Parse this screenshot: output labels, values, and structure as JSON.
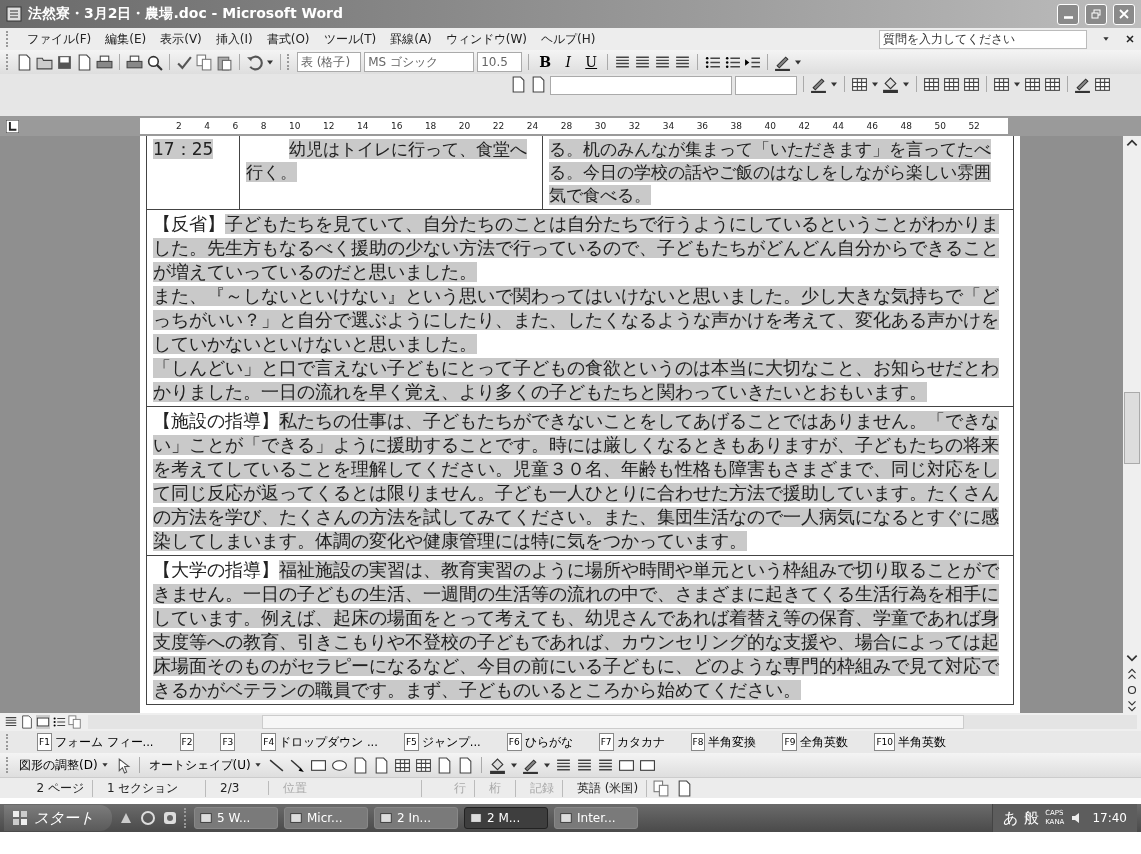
{
  "window": {
    "title": "法然寮・3月2日・農場.doc - Microsoft Word"
  },
  "menu": [
    {
      "label": "ファイル(F)"
    },
    {
      "label": "編集(E)"
    },
    {
      "label": "表示(V)"
    },
    {
      "label": "挿入(I)"
    },
    {
      "label": "書式(O)"
    },
    {
      "label": "ツール(T)"
    },
    {
      "label": "罫線(A)"
    },
    {
      "label": "ウィンドウ(W)"
    },
    {
      "label": "ヘルプ(H)"
    }
  ],
  "help_box": {
    "placeholder": "質問を入力してください"
  },
  "formatting": {
    "style": "表 (格子)",
    "font": "MS ゴシック",
    "size": "10.5",
    "buttons": [
      "B",
      "I",
      "U"
    ]
  },
  "ruler": [
    "2",
    "4",
    "6",
    "8",
    "10",
    "12",
    "14",
    "16",
    "18",
    "20",
    "22",
    "24",
    "28",
    "30",
    "32",
    "34",
    "36",
    "38",
    "40",
    "42",
    "44",
    "46",
    "48",
    "50",
    "52"
  ],
  "schedule_row": {
    "time": "17：25",
    "activity": "幼児はトイレに行って、食堂へ行く。",
    "support": "る。机のみんなが集まって「いただきます」を言ってたべる。今日の学校の話やご飯のはなしをしながら楽しい雰囲気で食べる。"
  },
  "sections": [
    {
      "label": "【反省】",
      "paragraphs": [
        "子どもたちを見ていて、自分たちのことは自分たちで行うようにしているということがわかりました。先生方もなるべく援助の少ない方法で行っているので、子どもたちがどんどん自分からできることが増えていっているのだと思いました。",
        "また、『～しないといけない』という思いで関わってはいけないと思いました。少し大きな気持ちで「どっちがいい？」と自分で選ぶようにしたり、また、したくなるような声かけを考えて、変化ある声かけをしていかないといけないと思いました。",
        "「しんどい」と口で言えない子どもにとって子どもの食欲というのは本当に大切なこと、お知らせだとわかりました。一日の流れを早く覚え、より多くの子どもたちと関わっていきたいとおもいます。"
      ]
    },
    {
      "label": "【施設の指導】",
      "paragraphs": [
        "私たちの仕事は、子どもたちができないことをしてあげることではありません。「できない」ことが「できる」ように援助することです。時には厳しくなるときもありますが、子どもたちの将来を考えてしていることを理解してください。児童３０名、年齢も性格も障害もさまざまで、同じ対応をして同じ反応が返ってくるとは限りません。子ども一人ひとりに合わせた方法で援助しています。たくさんの方法を学び、たくさんの方法を試してみてください。また、集団生活なので一人病気になるとすぐに感染してしまいます。体調の変化や健康管理には特に気をつかっています。"
      ]
    },
    {
      "label": "【大学の指導】",
      "paragraphs": [
        "福祉施設の実習は、教育実習のように場所や時間や単元という枠組みで切り取ることができません。一日の子どもの生活、一週間の生活等の流れの中で、さまざまに起きてくる生活行為を相手にしています。例えば、起床の場面をとって考えても、幼児さんであれば着替え等の保育、学童であれば身支度等への教育、引きこもりや不登校の子どもであれば、カウンセリング的な支援や、場合によっては起床場面そのものがセラピーになるなど、今目の前にいる子どもに、どのような専門的枠組みで見て対応できるかがベテランの職員です。まず、子どものいるところから始めてください。"
      ]
    }
  ],
  "function_keys": [
    {
      "key": "F1",
      "label": "フォーム フィー..."
    },
    {
      "key": "F2"
    },
    {
      "key": "F3"
    },
    {
      "key": "F4",
      "label": "ドロップダウン ..."
    },
    {
      "key": "F5",
      "label": "ジャンプ..."
    },
    {
      "key": "F6",
      "label": "ひらがな"
    },
    {
      "key": "F7",
      "label": "カタカナ"
    },
    {
      "key": "F8",
      "label": "半角変換"
    },
    {
      "key": "F9",
      "label": "全角英数"
    },
    {
      "key": "F10",
      "label": "半角英数"
    }
  ],
  "drawing_menus": [
    "図形の調整(D)",
    "オートシェイプ(U)"
  ],
  "status_bar": [
    {
      "text": "2 ページ",
      "disabled": false
    },
    {
      "text": "1 セクション",
      "disabled": false
    },
    {
      "text": "2/3",
      "disabled": false
    },
    {
      "text": "位置",
      "disabled": true
    },
    {
      "text": "行",
      "disabled": true
    },
    {
      "text": "桁",
      "disabled": true
    },
    {
      "text": "記録",
      "disabled": true
    },
    {
      "text": "英語 (米国)",
      "disabled": false
    }
  ],
  "taskbar": {
    "start": "スタート",
    "tasks": [
      {
        "label": "5 W...",
        "selected": false
      },
      {
        "label": "Micr...",
        "selected": false
      },
      {
        "label": "2 In...",
        "selected": false
      },
      {
        "label": "2 M...",
        "selected": true
      },
      {
        "label": "Inter...",
        "selected": false
      }
    ],
    "ime": [
      "あ",
      "般"
    ],
    "locks": [
      "CAPS",
      "KANA"
    ],
    "time": "17:40"
  }
}
